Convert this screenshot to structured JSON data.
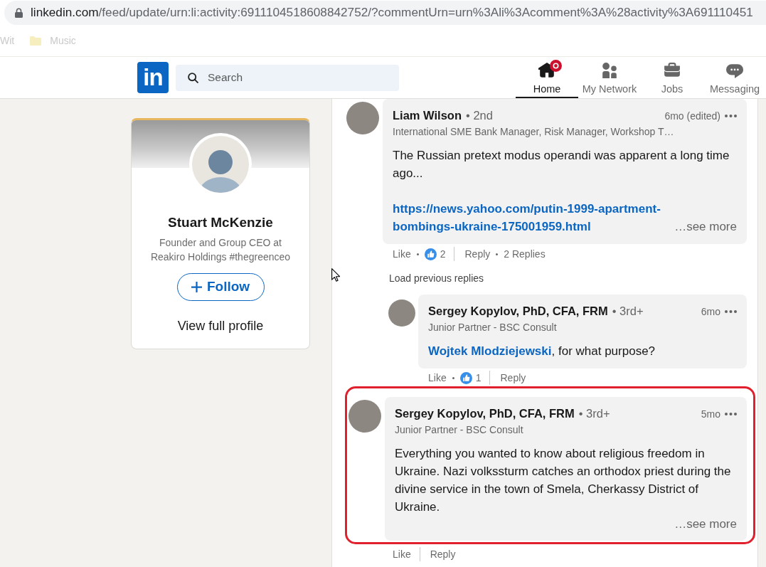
{
  "browser": {
    "url_host": "linkedin.com",
    "url_rest": "/feed/update/urn:li:activity:6911104518608842752/?commentUrn=urn%3Ali%3Acomment%3A%28activity%3A691110451"
  },
  "bookmarks": [
    {
      "label": "Wit",
      "kind": "page"
    },
    {
      "label": "Music",
      "kind": "folder"
    }
  ],
  "navbar": {
    "logo": "in",
    "search": {
      "placeholder": "Search"
    },
    "items": [
      {
        "label": "Home",
        "kind": "home",
        "selected": true,
        "notification": true
      },
      {
        "label": "My Network",
        "kind": "network",
        "selected": false,
        "notification": false
      },
      {
        "label": "Jobs",
        "kind": "jobs",
        "selected": false,
        "notification": false
      },
      {
        "label": "Messaging",
        "kind": "messaging",
        "selected": false,
        "notification": false
      }
    ]
  },
  "profile_card": {
    "name": "Stuart McKenzie",
    "headline": "Founder and Group CEO at Reakiro Holdings #thegreenceo",
    "follow_button": "Follow",
    "view_profile": "View full profile"
  },
  "comments": [
    {
      "author": "Liam Wilson",
      "degree": "• 2nd",
      "time": "6mo (edited)",
      "headline": "International SME Bank Manager, Risk Manager, Workshop T…",
      "highlighted": false,
      "body": [
        {
          "kind": "text",
          "text": "The Russian pretext modus operandi was apparent a long time ago..."
        },
        {
          "kind": "link",
          "text": "https://news.yahoo.com/putin-1999-apartment-bombings-ukraine-175001959.html"
        }
      ],
      "see_more": "…see more",
      "actions": {
        "like": "Like",
        "reactions": "2",
        "reply": "Reply",
        "replies": "2 Replies"
      },
      "replies_section": {
        "load_previous": "Load previous replies",
        "replies": [
          {
            "author": "Sergey Kopylov, PhD, CFA, FRM",
            "degree": "• 3rd+",
            "time": "6mo",
            "headline": "Junior Partner - BSC Consult",
            "highlighted": false,
            "body": [
              {
                "kind": "mention",
                "mention": "Wojtek Mlodziejewski",
                "text": ", for what purpose?"
              }
            ],
            "actions": {
              "like": "Like",
              "reactions": "1",
              "reply": "Reply"
            }
          }
        ]
      }
    },
    {
      "author": "Sergey Kopylov, PhD, CFA, FRM",
      "degree": "• 3rd+",
      "time": "5mo",
      "headline": "Junior Partner - BSC Consult",
      "highlighted": true,
      "body": [
        {
          "kind": "text",
          "text": "Everything you wanted to know about religious freedom in Ukraine. Nazi volkssturm catches an orthodox priest during the divine service in the town of Smela, Cherkassy District of Ukraine."
        }
      ],
      "see_more": "…see more",
      "actions": {
        "like": "Like",
        "reply": "Reply"
      }
    }
  ]
}
